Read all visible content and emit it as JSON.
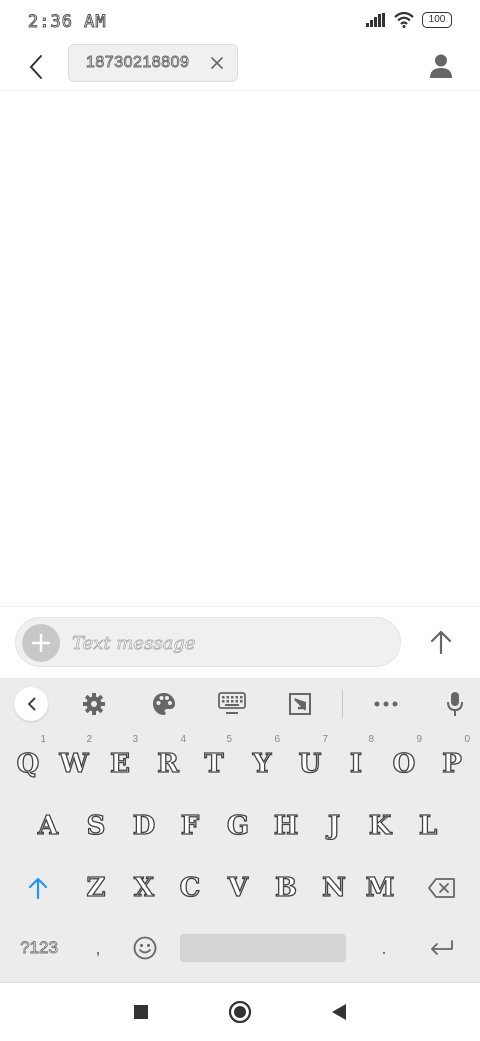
{
  "status_bar": {
    "time": "2:36 AM",
    "battery": "100"
  },
  "header": {
    "recipient": "18730218809"
  },
  "compose": {
    "placeholder": "Text message"
  },
  "keyboard": {
    "row1": [
      {
        "label": "Q",
        "hint": "1"
      },
      {
        "label": "W",
        "hint": "2"
      },
      {
        "label": "E",
        "hint": "3"
      },
      {
        "label": "R",
        "hint": "4"
      },
      {
        "label": "T",
        "hint": "5"
      },
      {
        "label": "Y",
        "hint": "6"
      },
      {
        "label": "U",
        "hint": "7"
      },
      {
        "label": "I",
        "hint": "8"
      },
      {
        "label": "O",
        "hint": "9"
      },
      {
        "label": "P",
        "hint": "0"
      }
    ],
    "row2": [
      "A",
      "S",
      "D",
      "F",
      "G",
      "H",
      "J",
      "K",
      "L"
    ],
    "row3": [
      "Z",
      "X",
      "C",
      "V",
      "B",
      "N",
      "M"
    ],
    "symbols_label": "?123",
    "comma_label": ",",
    "period_label": "."
  },
  "colors": {
    "accent": "#2196f3",
    "keyboard_bg": "#ececec",
    "icon_gray": "#666666"
  }
}
